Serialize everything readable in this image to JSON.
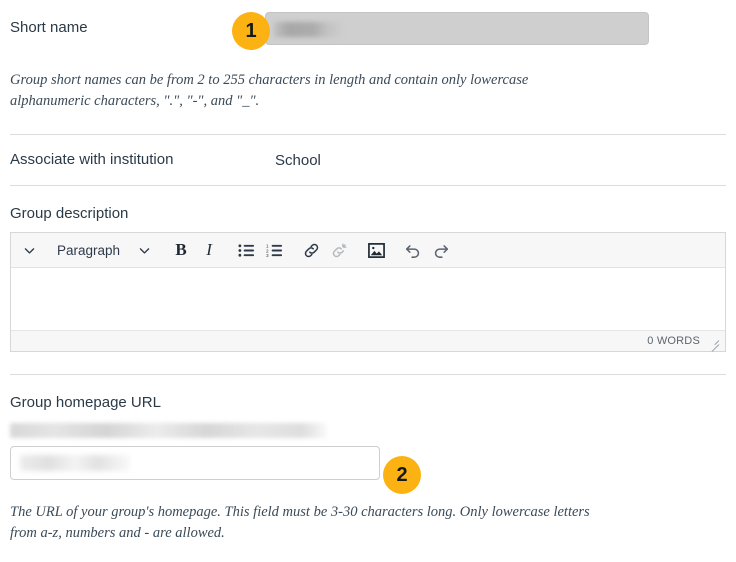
{
  "form": {
    "short_name": {
      "label": "Short name",
      "value": "",
      "disabled": true,
      "badge": "1",
      "help": "Group short names can be from 2 to 255 characters in length and contain only lowercase alphanumeric characters, \".\", \"-\", and \"_\"."
    },
    "institution": {
      "label": "Associate with institution",
      "value": "School"
    },
    "description": {
      "label": "Group description",
      "editor": {
        "style_select": "Paragraph",
        "buttons": [
          {
            "name": "chevron-down-icon",
            "title": "Toggle toolbar"
          },
          {
            "name": "paragraph-style-select",
            "title": "Paragraph"
          },
          {
            "name": "chevron-down-icon",
            "title": "Open styles"
          },
          {
            "name": "bold-button",
            "title": "B"
          },
          {
            "name": "italic-button",
            "title": "I"
          },
          {
            "name": "bullet-list-button",
            "title": "Bulleted list"
          },
          {
            "name": "numbered-list-button",
            "title": "Numbered list"
          },
          {
            "name": "link-button",
            "title": "Insert link"
          },
          {
            "name": "unlink-button",
            "title": "Remove link"
          },
          {
            "name": "image-button",
            "title": "Insert image"
          },
          {
            "name": "undo-button",
            "title": "Undo"
          },
          {
            "name": "redo-button",
            "title": "Redo"
          }
        ],
        "content": "",
        "word_count": "0 WORDS"
      }
    },
    "homepage_url": {
      "label": "Group homepage URL",
      "prefix": "",
      "value": "",
      "badge": "2",
      "help": "The URL of your group's homepage. This field must be 3-30 characters long. Only lowercase letters from a-z, numbers and - are allowed."
    }
  },
  "colors": {
    "badge_background": "#fbb212",
    "badge_text": "#16181a",
    "text": "#2b3a47",
    "divider": "#dcdcdc",
    "toolbar_background": "#f7f7f7",
    "disabled_input": "#cfcfcf"
  }
}
